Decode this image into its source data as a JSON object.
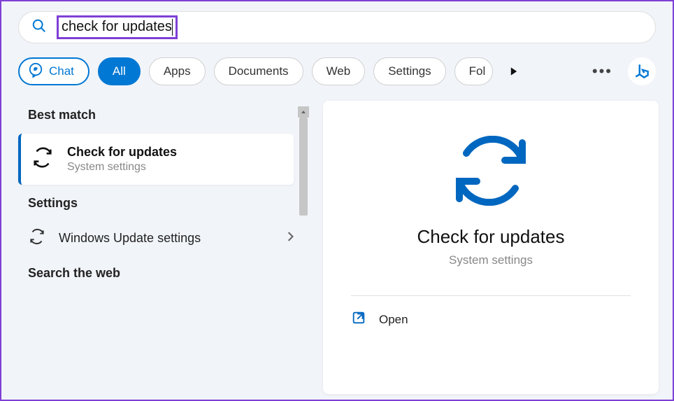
{
  "search": {
    "query": "check for updates"
  },
  "filters": {
    "chat": "Chat",
    "all": "All",
    "apps": "Apps",
    "documents": "Documents",
    "web": "Web",
    "settings": "Settings",
    "folders": "Folders"
  },
  "sections": {
    "best_match": "Best match",
    "settings": "Settings",
    "search_web": "Search the web"
  },
  "best_match_item": {
    "title": "Check for updates",
    "subtitle": "System settings"
  },
  "settings_items": [
    {
      "label": "Windows Update settings"
    }
  ],
  "detail": {
    "title": "Check for updates",
    "subtitle": "System settings",
    "actions": {
      "open": "Open"
    }
  },
  "colors": {
    "accent": "#0078d4",
    "highlight": "#7e3fd6"
  }
}
